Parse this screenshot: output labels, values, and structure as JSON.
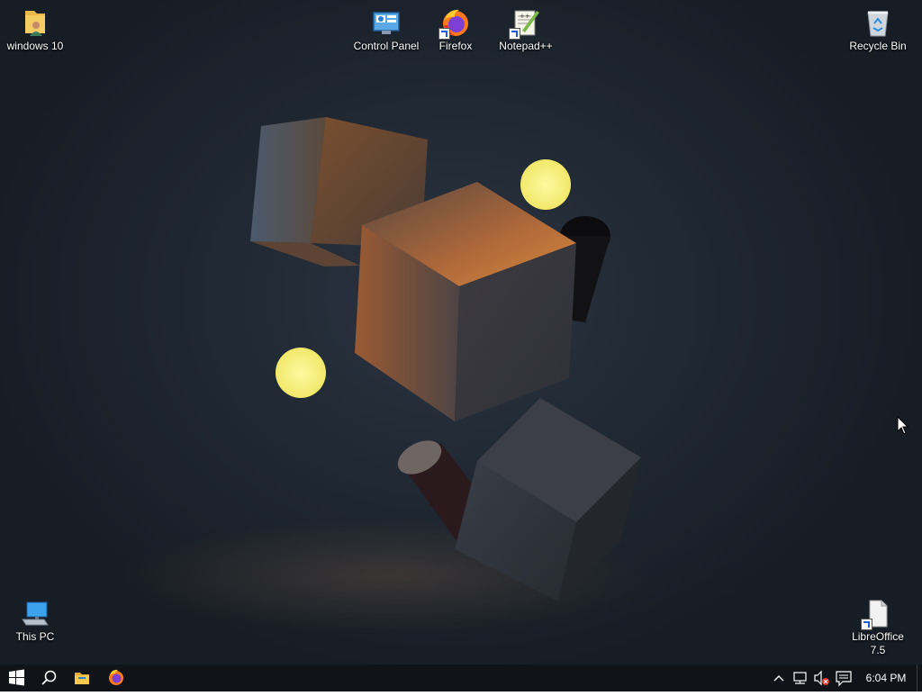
{
  "desktop": {
    "icons": [
      {
        "label": "windows 10",
        "glyph": "user-folder-icon"
      },
      {
        "label": "Control Panel",
        "glyph": "control-panel-icon"
      },
      {
        "label": "Firefox",
        "glyph": "firefox-icon"
      },
      {
        "label": "Notepad++",
        "glyph": "notepad-plus-plus-icon"
      },
      {
        "label": "Recycle Bin",
        "glyph": "recycle-bin-icon"
      },
      {
        "label": "This PC",
        "glyph": "this-pc-icon"
      },
      {
        "label": "LibreOffice 7.5",
        "glyph": "libreoffice-icon"
      }
    ]
  },
  "taskbar": {
    "pinned": [
      {
        "name": "start-button",
        "icon": "windows-logo-icon"
      },
      {
        "name": "search-button",
        "icon": "search-icon"
      },
      {
        "name": "file-explorer-button",
        "icon": "folder-icon"
      },
      {
        "name": "firefox-taskbar-button",
        "icon": "firefox-icon"
      }
    ],
    "tray": {
      "icons": [
        "chevron-up-icon",
        "network-icon",
        "volume-muted-icon",
        "notification-icon"
      ]
    },
    "clock": "6:04 PM"
  },
  "colors": {
    "wallpaper": "#1f2731",
    "taskbar": "#101318",
    "orb": "#f6f27a",
    "folder": "#e8b84a",
    "windows_blue": "#2aa1f0"
  }
}
